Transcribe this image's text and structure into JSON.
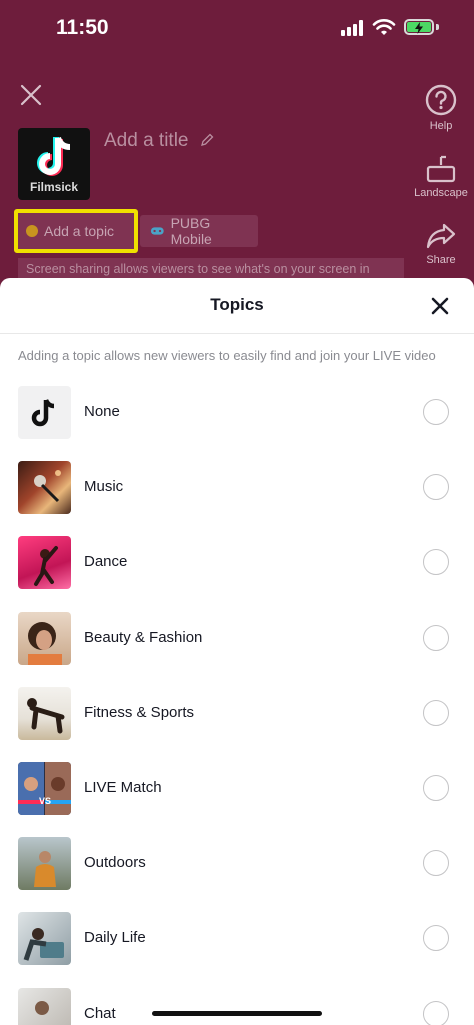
{
  "status_bar": {
    "time": "11:50"
  },
  "header": {
    "title_placeholder": "Add a title",
    "cover_caption": "Filmsick"
  },
  "side_actions": [
    {
      "label": "Help",
      "icon": "help-icon"
    },
    {
      "label": "Landscape",
      "icon": "landscape-icon"
    },
    {
      "label": "Share",
      "icon": "share-icon"
    }
  ],
  "chips": {
    "topic_label": "Add a topic",
    "game_label": "PUBG Mobile"
  },
  "info_line": "Screen sharing allows viewers to see what's on your screen in",
  "sheet": {
    "title": "Topics",
    "hint": "Adding a topic allows new viewers to easily find and join your LIVE video",
    "items": [
      {
        "label": "None",
        "icon": "tiktok-logo-icon",
        "selected": false
      },
      {
        "label": "Music",
        "icon": "music-thumbnail",
        "selected": false
      },
      {
        "label": "Dance",
        "icon": "dance-thumbnail",
        "selected": false
      },
      {
        "label": "Beauty & Fashion",
        "icon": "beauty-thumbnail",
        "selected": false
      },
      {
        "label": "Fitness & Sports",
        "icon": "fitness-thumbnail",
        "selected": false
      },
      {
        "label": "LIVE Match",
        "icon": "live-match-thumbnail",
        "selected": false
      },
      {
        "label": "Outdoors",
        "icon": "outdoors-thumbnail",
        "selected": false
      },
      {
        "label": "Daily Life",
        "icon": "daily-life-thumbnail",
        "selected": false
      },
      {
        "label": "Chat",
        "icon": "chat-thumbnail",
        "selected": false
      }
    ]
  },
  "colors": {
    "background": "#6e1d3c",
    "highlight": "#f0e000",
    "sheet": "#ffffff",
    "text": "#161823"
  }
}
